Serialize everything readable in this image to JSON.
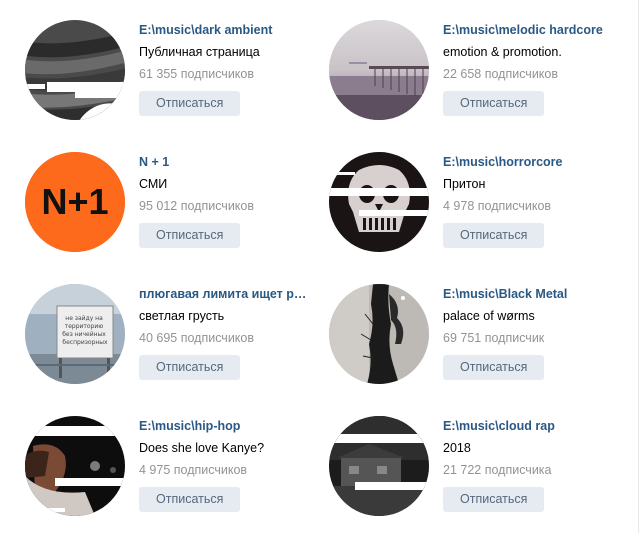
{
  "groups": [
    {
      "name": "E:\\music\\dark ambient",
      "description": "Публичная страница",
      "subscribers": "61 355 подписчиков",
      "button": "Отписаться"
    },
    {
      "name": "E:\\music\\melodic hardcore",
      "description": "emotion & promotion.",
      "subscribers": "22 658 подписчиков",
      "button": "Отписаться"
    },
    {
      "name": "N + 1",
      "description": "СМИ",
      "subscribers": "95 012 подписчиков",
      "button": "Отписаться",
      "avatar_text": "N+1"
    },
    {
      "name": "E:\\music\\horrorcore",
      "description": "Притон",
      "subscribers": "4 978 подписчиков",
      "button": "Отписаться"
    },
    {
      "name": "плюгавая лимита ищет ра...",
      "description": "светлая грусть",
      "subscribers": "40 695 подписчиков",
      "button": "Отписаться",
      "avatar_text": "не зайду на территорию без ничейных беспризорных"
    },
    {
      "name": "E:\\music\\Black Metal",
      "description": "palace of wørms",
      "subscribers": "69 751 подписчик",
      "button": "Отписаться"
    },
    {
      "name": "E:\\music\\hip-hop",
      "description": "Does she love Kanye?",
      "subscribers": "4 975 подписчиков",
      "button": "Отписаться"
    },
    {
      "name": "E:\\music\\cloud rap",
      "description": "2018",
      "subscribers": "21 722 подписчика",
      "button": "Отписаться"
    }
  ],
  "colors": {
    "link": "#2a5885",
    "muted": "#939393",
    "button_bg": "#e5ebf1",
    "button_text": "#55677d",
    "n1_orange": "#fd6a1c"
  }
}
